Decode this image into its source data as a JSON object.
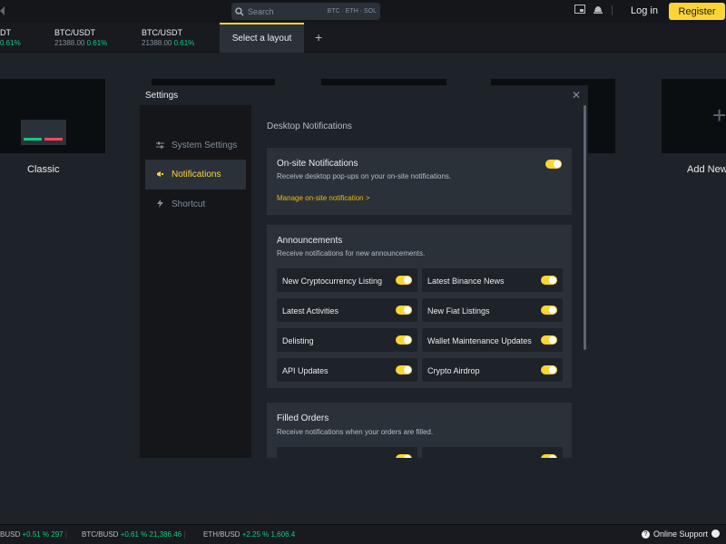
{
  "topbar": {
    "search_placeholder": "Search",
    "search_tags": "BTC · ETH · SOL",
    "login": "Log in",
    "register": "Register"
  },
  "tickers": [
    {
      "symbol": "DT",
      "price": "",
      "change": "0.61%"
    },
    {
      "symbol": "BTC/USDT",
      "price": "21388.00",
      "change": "0.61%"
    },
    {
      "symbol": "BTC/USDT",
      "price": "21388.00",
      "change": "0.61%"
    }
  ],
  "layout_tab": "Select a layout",
  "layouts": {
    "classic": "Classic",
    "add_new": "Add New"
  },
  "settings": {
    "title": "Settings",
    "nav": [
      {
        "label": "System Settings",
        "icon": "sliders-icon"
      },
      {
        "label": "Notifications",
        "icon": "megaphone-icon"
      },
      {
        "label": "Shortcut",
        "icon": "bolt-icon"
      }
    ],
    "section_title": "Desktop Notifications",
    "onsite": {
      "title": "On-site Notifications",
      "desc": "Receive desktop pop-ups on your on-site notifications.",
      "link": "Manage on-site notification >"
    },
    "announcements": {
      "title": "Announcements",
      "desc": "Receive notifications for new announcements.",
      "options": [
        "New Cryptocurrency Listing",
        "Latest Binance News",
        "Latest Activities",
        "New Fiat Listings",
        "Delisting",
        "Wallet Maintenance Updates",
        "API Updates",
        "Crypto Airdrop"
      ]
    },
    "filled_orders": {
      "title": "Filled Orders",
      "desc": "Receive notifications when your orders are filled."
    }
  },
  "bottombar": {
    "items": [
      {
        "symbol": "BUSD",
        "change": "+0.51 %",
        "price": "297"
      },
      {
        "symbol": "BTC/BUSD",
        "change": "+0.61 %",
        "price": "21,386.46"
      },
      {
        "symbol": "ETH/BUSD",
        "change": "+2.25 %",
        "price": "1,606.4"
      }
    ],
    "support": "Online Support"
  },
  "colors": {
    "accent": "#fcd535",
    "up": "#0ecb81",
    "down": "#f6465d"
  }
}
